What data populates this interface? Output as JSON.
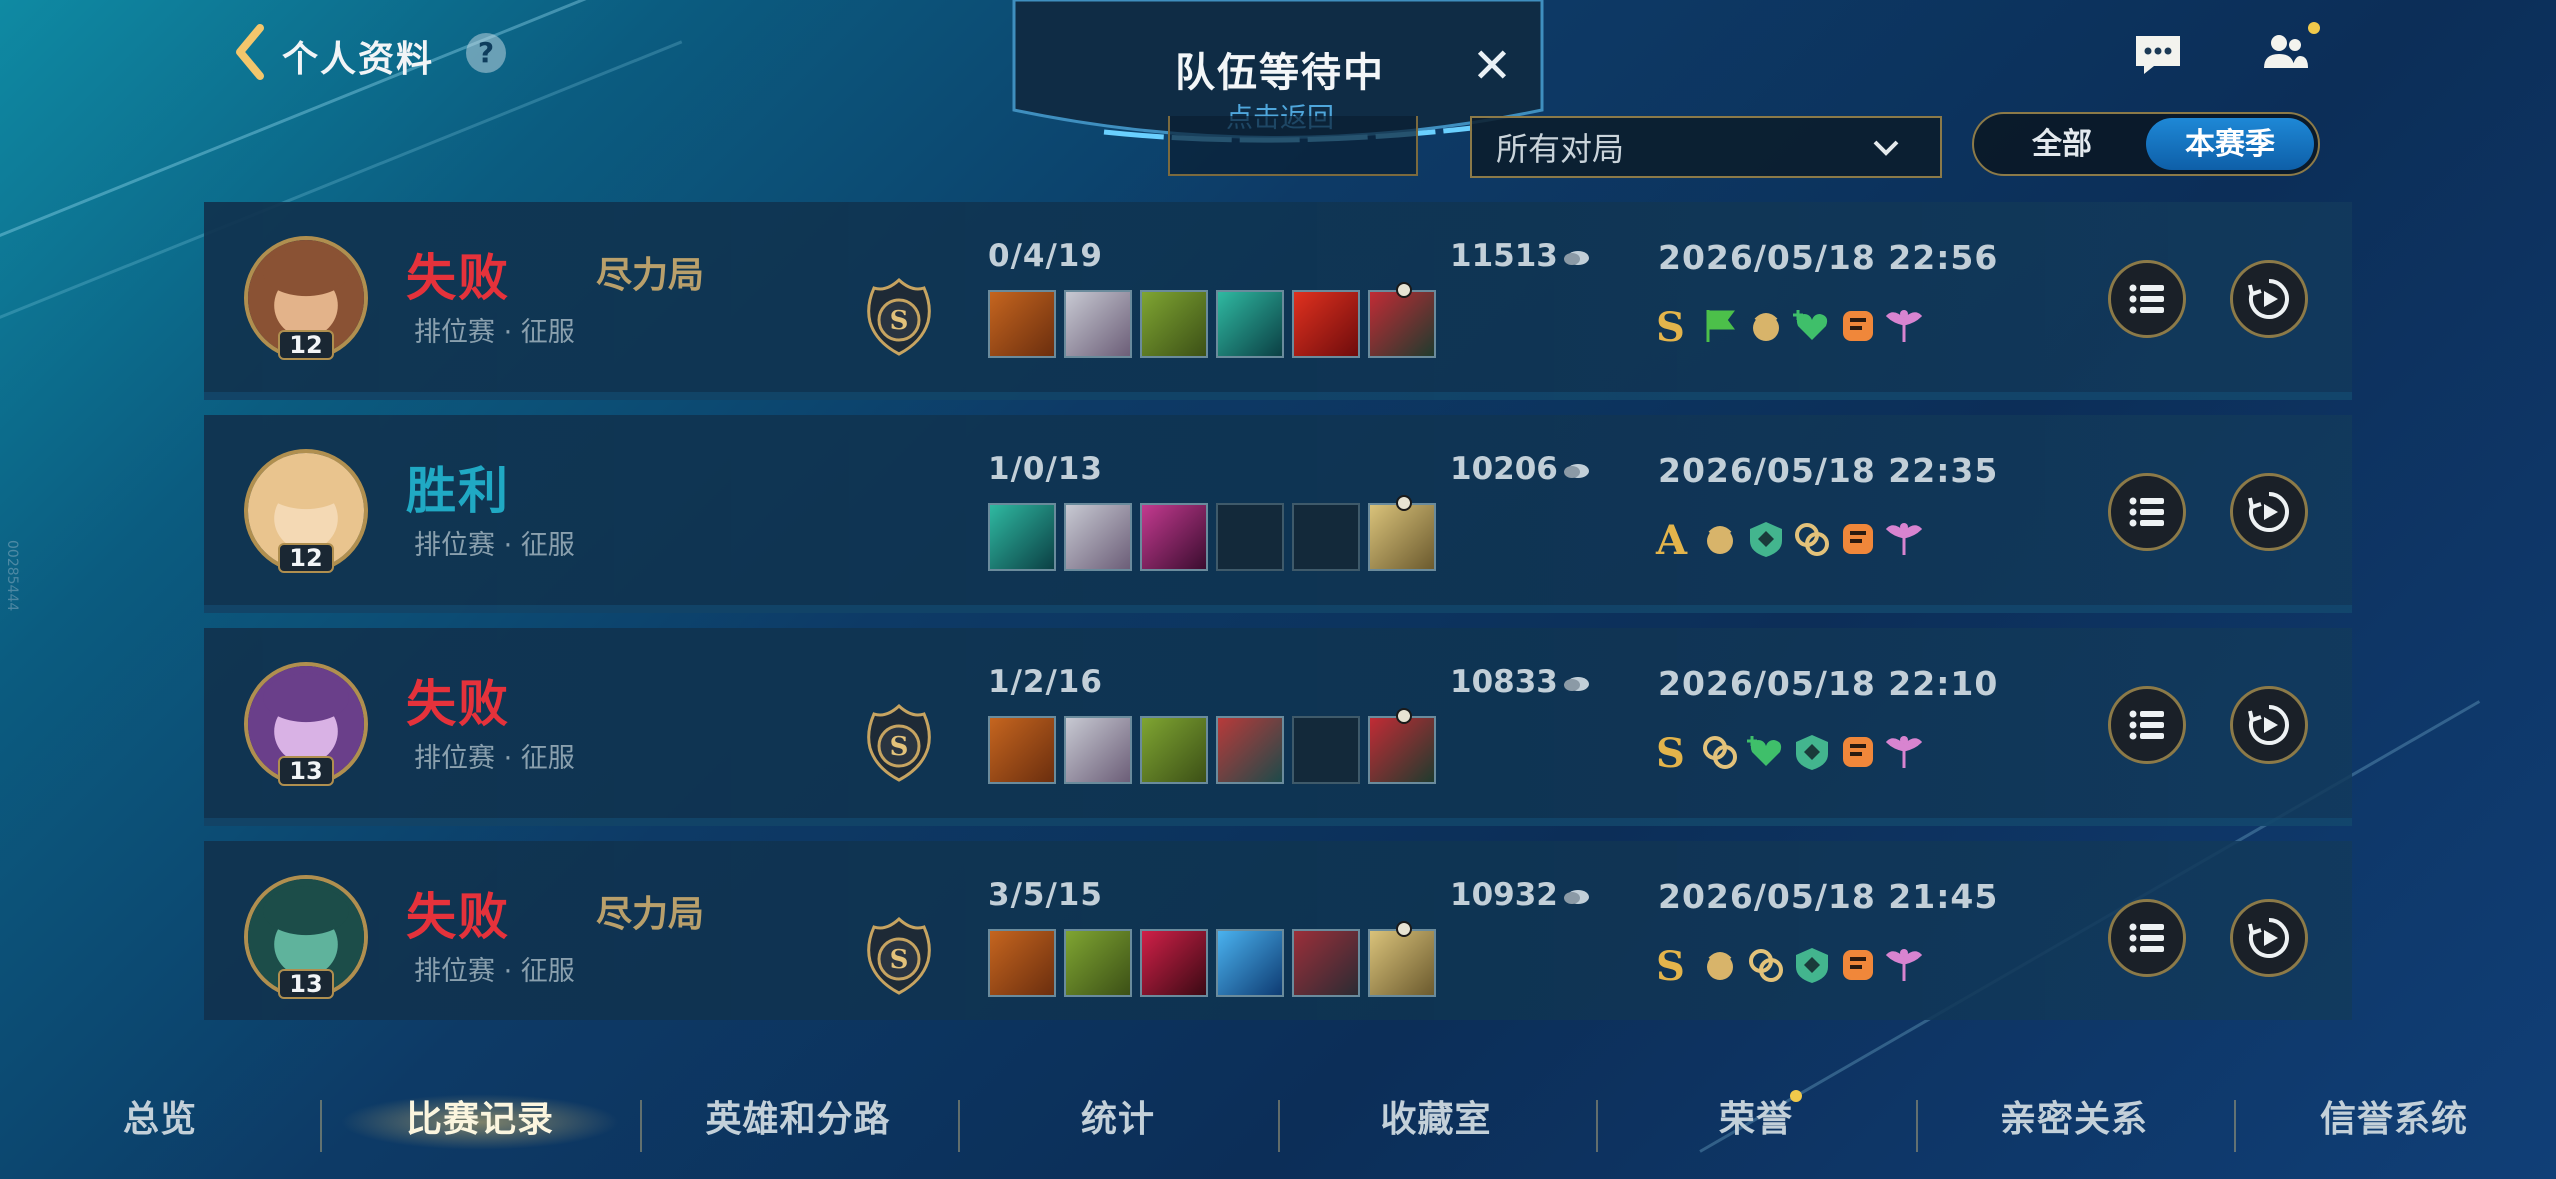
{
  "header": {
    "title": "个人资料",
    "help": "?"
  },
  "queue": {
    "title": "队伍等待中",
    "subtitle": "点击返回",
    "close": "✕"
  },
  "filters": {
    "dropdown_value": "所有对局",
    "toggle": [
      "全部",
      "本赛季"
    ],
    "toggle_active": "本赛季"
  },
  "matches": [
    {
      "result": "失败",
      "result_type": "lose",
      "tag": "尽力局",
      "mode": "排位赛 · 征服",
      "level": "12",
      "kda": "0/4/19",
      "gold": "11513",
      "datetime": "2026/05/18 22:56",
      "grade": "S",
      "items": [
        "orange",
        "silver",
        "green",
        "teal",
        "red",
        "boot"
      ],
      "badges": [
        "flag-icon",
        "carry-icon",
        "heal-icon",
        "cc-icon",
        "wing-icon"
      ]
    },
    {
      "result": "胜利",
      "result_type": "win",
      "tag": "",
      "mode": "排位赛 · 征服",
      "level": "12",
      "kda": "1/0/13",
      "gold": "10206",
      "datetime": "2026/05/18 22:35",
      "grade": "A",
      "items": [
        "teal",
        "silver",
        "magenta",
        "empty",
        "empty",
        "armor"
      ],
      "badges": [
        "carry-icon",
        "shield-icon",
        "chain-icon",
        "cc-icon",
        "wing-icon"
      ]
    },
    {
      "result": "失败",
      "result_type": "lose",
      "tag": "",
      "mode": "排位赛 · 征服",
      "level": "13",
      "kda": "1/2/16",
      "gold": "10833",
      "datetime": "2026/05/18 22:10",
      "grade": "S",
      "items": [
        "orange",
        "silver",
        "green",
        "crimson",
        "empty",
        "boot"
      ],
      "badges": [
        "chain-icon",
        "heal-icon",
        "shield-icon",
        "cc-icon",
        "wing-icon"
      ]
    },
    {
      "result": "失败",
      "result_type": "lose",
      "tag": "尽力局",
      "mode": "排位赛 · 征服",
      "level": "13",
      "kda": "3/5/15",
      "gold": "10932",
      "datetime": "2026/05/18 21:45",
      "grade": "S",
      "items": [
        "orange",
        "green",
        "ruby",
        "blue",
        "dark",
        "armor"
      ],
      "badges": [
        "carry-icon",
        "chain-icon",
        "shield-icon",
        "cc-icon",
        "wing-icon"
      ]
    }
  ],
  "nav": {
    "items": [
      "总览",
      "比赛记录",
      "英雄和分路",
      "统计",
      "收藏室",
      "荣誉",
      "亲密关系",
      "信誉系统"
    ],
    "active": "比赛记录"
  },
  "colors": {
    "lose": "#e5323b",
    "win": "#20a9c4",
    "gold_accent": "#8c7a48",
    "toggle_active": "#1e88d6"
  },
  "side_code": "00285444"
}
